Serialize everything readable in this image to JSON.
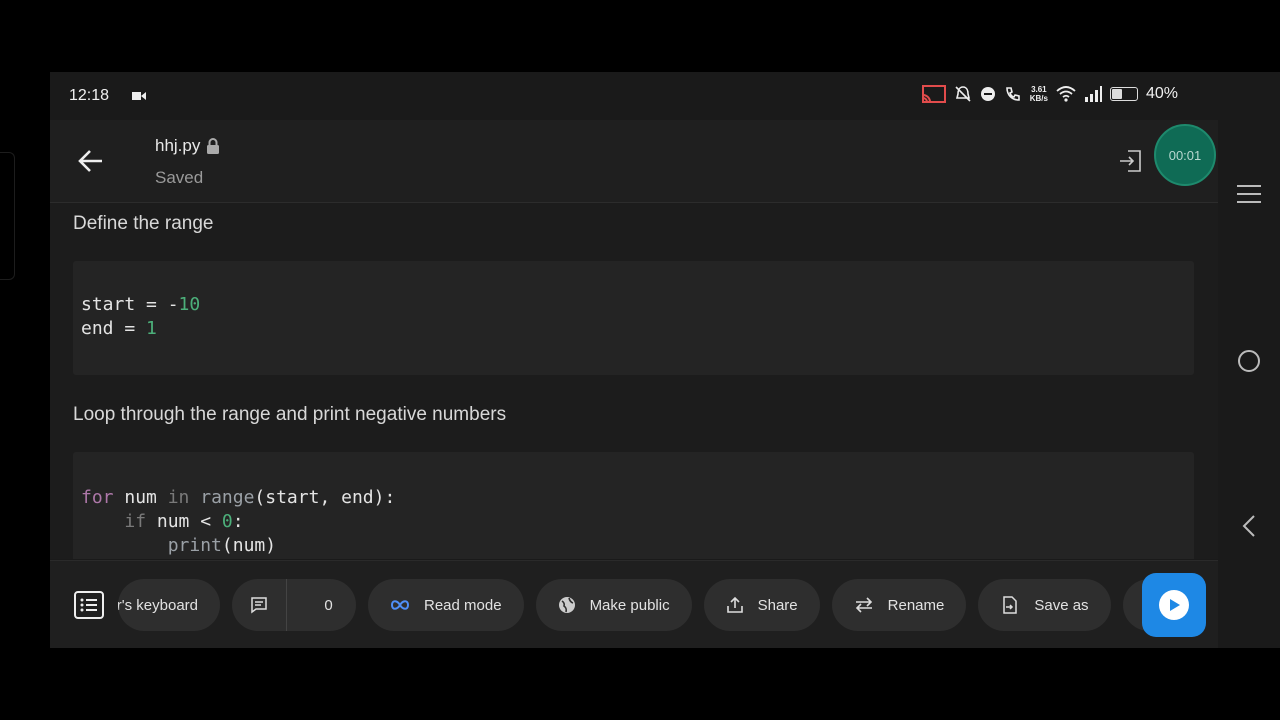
{
  "status_bar": {
    "time": "12:18",
    "net_speed_value": "3.61",
    "net_speed_unit": "KB/s",
    "battery": "40%",
    "battery_level": 0.4
  },
  "header": {
    "file_name": "hhj.py",
    "save_status": "Saved",
    "timer": "00:01",
    "accent_color": "#0f6b55"
  },
  "content": {
    "heading_1": "Define the range",
    "code_1": {
      "line1": {
        "var": "start",
        "op": " = -",
        "num": "10"
      },
      "line2": {
        "var": "end",
        "op": " = ",
        "num": "1"
      }
    },
    "heading_2": "Loop through the range and print negative numbers",
    "code_2": {
      "l1_kw": "for",
      "l1_var": " num ",
      "l1_in": "in",
      "l1_fn": " range",
      "l1_rest": "(start, end):",
      "l2_kw": "if",
      "l2_rest": " num < ",
      "l2_num": "0",
      "l2_colon": ":",
      "l3_fn": "print",
      "l3_rest": "(num)"
    }
  },
  "bottom_bar": {
    "keyboard_label": "er's keyboard",
    "comment_count": "0",
    "read_mode_label": "Read mode",
    "make_public_label": "Make public",
    "share_label": "Share",
    "rename_label": "Rename",
    "save_as_label": "Save as",
    "run_color": "#1e88e5"
  },
  "icons": [
    "back-arrow-icon",
    "lock-icon",
    "exit-icon",
    "table-of-contents-icon",
    "comment-icon",
    "infinity-icon",
    "globe-icon",
    "share-icon",
    "rename-swap-icon",
    "save-as-icon",
    "play-icon",
    "menu-icon",
    "home-circle-icon",
    "back-chevron-icon"
  ]
}
